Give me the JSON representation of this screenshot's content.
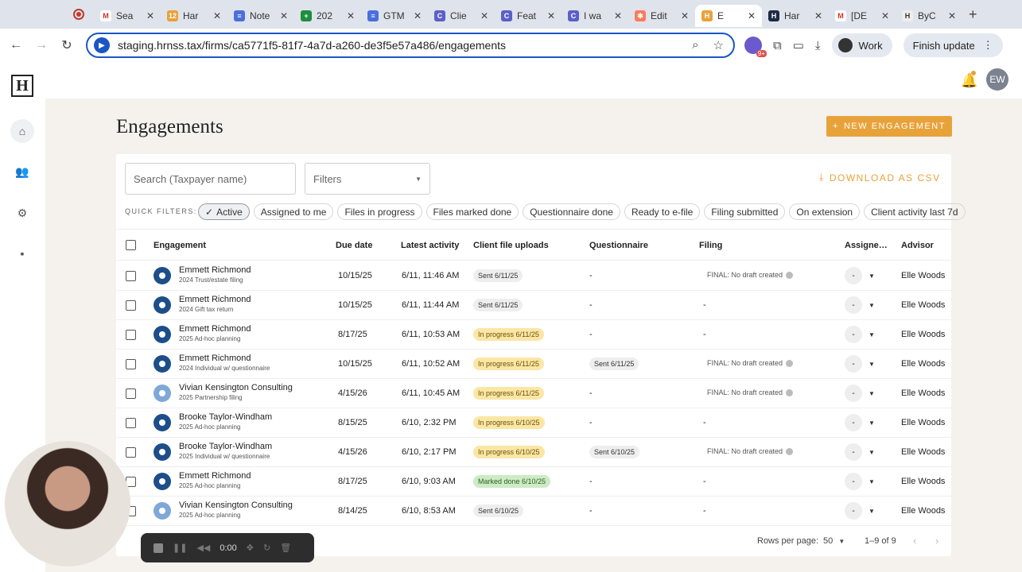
{
  "browser": {
    "tabs": [
      {
        "label": "Sea",
        "color": "#ffffff",
        "glyph": "M",
        "glyph_color": "#d93025"
      },
      {
        "label": "Har",
        "color": "#e8a23a",
        "glyph": "12"
      },
      {
        "label": "Note",
        "color": "#4a6fdc",
        "glyph": "≡"
      },
      {
        "label": "202",
        "color": "#1e8e3e",
        "glyph": "+"
      },
      {
        "label": "GTM",
        "color": "#4a6fdc",
        "glyph": "≡"
      },
      {
        "label": "Clie",
        "color": "#5b5fc7",
        "glyph": "C"
      },
      {
        "label": "Feat",
        "color": "#5b5fc7",
        "glyph": "C"
      },
      {
        "label": "I wa",
        "color": "#5b5fc7",
        "glyph": "C"
      },
      {
        "label": "Edit",
        "color": "#ff7a59",
        "glyph": "✱"
      },
      {
        "label": "E",
        "color": "#e8a23a",
        "glyph": "H"
      },
      {
        "label": "Har",
        "color": "#1c2a44",
        "glyph": "H"
      },
      {
        "label": "[DE",
        "color": "#ffffff",
        "glyph": "M",
        "glyph_color": "#d93025"
      },
      {
        "label": "ByC",
        "color": "#eeeeee",
        "glyph": "H",
        "glyph_color": "#333"
      }
    ],
    "url": "staging.hrnss.tax/firms/ca5771f5-81f7-4a7d-a260-de3f5e57a486/engagements",
    "ext_badge": "9+",
    "profile_label": "Work",
    "finish_update_label": "Finish update"
  },
  "header": {
    "avatar_initials": "EW"
  },
  "page": {
    "title": "Engagements",
    "new_button": "NEW ENGAGEMENT",
    "search_placeholder": "Search (Taxpayer name)",
    "filters_label": "Filters",
    "download_label": "DOWNLOAD AS CSV",
    "quick_filters_label": "QUICK FILTERS:",
    "quick_filters": [
      {
        "label": "Active",
        "active": true
      },
      {
        "label": "Assigned to me"
      },
      {
        "label": "Files in progress"
      },
      {
        "label": "Files marked done"
      },
      {
        "label": "Questionnaire done"
      },
      {
        "label": "Ready to e-file"
      },
      {
        "label": "Filing submitted"
      },
      {
        "label": "On extension"
      },
      {
        "label": "Client activity last 7d"
      }
    ]
  },
  "table": {
    "columns": {
      "engagement": "Engagement",
      "due_date": "Due date",
      "latest_activity": "Latest activity",
      "uploads": "Client file uploads",
      "questionnaire": "Questionnaire",
      "filing": "Filing",
      "assignee": "Assigne…",
      "advisor": "Advisor"
    },
    "rows": [
      {
        "name": "Emmett Richmond",
        "sub": "2024 Trust/estate filing",
        "type": "person",
        "due": "10/15/25",
        "activity": "6/11, 11:46 AM",
        "upload": "Sent 6/11/25",
        "upload_status": "grey",
        "questionnaire": "-",
        "q_status": "",
        "filing": "FINAL: No draft created",
        "assignee": "-",
        "advisor": "Elle Woods"
      },
      {
        "name": "Emmett Richmond",
        "sub": "2024 Gift tax return",
        "type": "person",
        "due": "10/15/25",
        "activity": "6/11, 11:44 AM",
        "upload": "Sent 6/11/25",
        "upload_status": "grey",
        "questionnaire": "-",
        "q_status": "",
        "filing": "-",
        "assignee": "-",
        "advisor": "Elle Woods"
      },
      {
        "name": "Emmett Richmond",
        "sub": "2025 Ad-hoc planning",
        "type": "person",
        "due": "8/17/25",
        "activity": "6/11, 10:53 AM",
        "upload": "In progress 6/11/25",
        "upload_status": "yellow",
        "questionnaire": "-",
        "q_status": "",
        "filing": "-",
        "assignee": "-",
        "advisor": "Elle Woods"
      },
      {
        "name": "Emmett Richmond",
        "sub": "2024 Individual w/ questionnaire",
        "type": "person",
        "due": "10/15/25",
        "activity": "6/11, 10:52 AM",
        "upload": "In progress 6/11/25",
        "upload_status": "yellow",
        "questionnaire": "Sent 6/11/25",
        "q_status": "grey",
        "filing": "FINAL: No draft created",
        "assignee": "-",
        "advisor": "Elle Woods"
      },
      {
        "name": "Vivian Kensington Consulting",
        "sub": "2025 Partnership filing",
        "type": "business",
        "due": "4/15/26",
        "activity": "6/11, 10:45 AM",
        "upload": "In progress 6/11/25",
        "upload_status": "yellow",
        "questionnaire": "-",
        "q_status": "",
        "filing": "FINAL: No draft created",
        "assignee": "-",
        "advisor": "Elle Woods"
      },
      {
        "name": "Brooke Taylor-Windham",
        "sub": "2025 Ad-hoc planning",
        "type": "person",
        "due": "8/15/25",
        "activity": "6/10, 2:32 PM",
        "upload": "In progress 6/10/25",
        "upload_status": "yellow",
        "questionnaire": "-",
        "q_status": "",
        "filing": "-",
        "assignee": "-",
        "advisor": "Elle Woods"
      },
      {
        "name": "Brooke Taylor-Windham",
        "sub": "2025 Individual w/ questionnaire",
        "type": "person",
        "due": "4/15/26",
        "activity": "6/10, 2:17 PM",
        "upload": "In progress 6/10/25",
        "upload_status": "yellow",
        "questionnaire": "Sent 6/10/25",
        "q_status": "grey",
        "filing": "FINAL: No draft created",
        "assignee": "-",
        "advisor": "Elle Woods"
      },
      {
        "name": "Emmett Richmond",
        "sub": "2025 Ad-hoc planning",
        "type": "person",
        "due": "8/17/25",
        "activity": "6/10, 9:03 AM",
        "upload": "Marked done 6/10/25",
        "upload_status": "green",
        "questionnaire": "-",
        "q_status": "",
        "filing": "-",
        "assignee": "-",
        "advisor": "Elle Woods"
      },
      {
        "name": "Vivian Kensington Consulting",
        "sub": "2025 Ad-hoc planning",
        "type": "business",
        "due": "8/14/25",
        "activity": "6/10, 8:53 AM",
        "upload": "Sent 6/10/25",
        "upload_status": "grey",
        "questionnaire": "-",
        "q_status": "",
        "filing": "-",
        "assignee": "-",
        "advisor": "Elle Woods"
      }
    ]
  },
  "pagination": {
    "rows_per_page_label": "Rows per page:",
    "rows_per_page": "50",
    "range": "1–9 of 9"
  },
  "recorder": {
    "time": "0:00"
  },
  "colors": {
    "accent": "#e8a23a",
    "navy": "#1d4e89",
    "focus": "#1a56c4"
  }
}
